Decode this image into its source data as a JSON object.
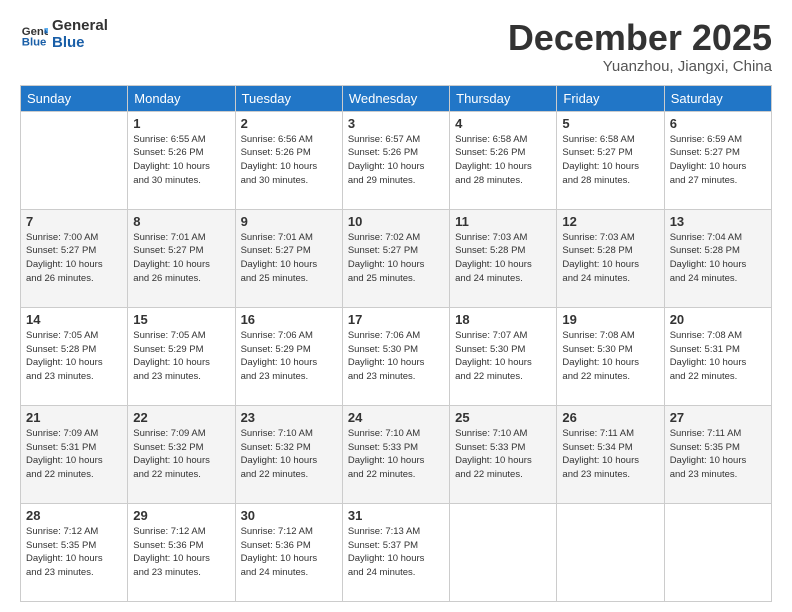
{
  "logo": {
    "line1": "General",
    "line2": "Blue"
  },
  "title": "December 2025",
  "subtitle": "Yuanzhou, Jiangxi, China",
  "days_of_week": [
    "Sunday",
    "Monday",
    "Tuesday",
    "Wednesday",
    "Thursday",
    "Friday",
    "Saturday"
  ],
  "weeks": [
    [
      {
        "day": "",
        "info": ""
      },
      {
        "day": "1",
        "info": "Sunrise: 6:55 AM\nSunset: 5:26 PM\nDaylight: 10 hours\nand 30 minutes."
      },
      {
        "day": "2",
        "info": "Sunrise: 6:56 AM\nSunset: 5:26 PM\nDaylight: 10 hours\nand 30 minutes."
      },
      {
        "day": "3",
        "info": "Sunrise: 6:57 AM\nSunset: 5:26 PM\nDaylight: 10 hours\nand 29 minutes."
      },
      {
        "day": "4",
        "info": "Sunrise: 6:58 AM\nSunset: 5:26 PM\nDaylight: 10 hours\nand 28 minutes."
      },
      {
        "day": "5",
        "info": "Sunrise: 6:58 AM\nSunset: 5:27 PM\nDaylight: 10 hours\nand 28 minutes."
      },
      {
        "day": "6",
        "info": "Sunrise: 6:59 AM\nSunset: 5:27 PM\nDaylight: 10 hours\nand 27 minutes."
      }
    ],
    [
      {
        "day": "7",
        "info": "Sunrise: 7:00 AM\nSunset: 5:27 PM\nDaylight: 10 hours\nand 26 minutes."
      },
      {
        "day": "8",
        "info": "Sunrise: 7:01 AM\nSunset: 5:27 PM\nDaylight: 10 hours\nand 26 minutes."
      },
      {
        "day": "9",
        "info": "Sunrise: 7:01 AM\nSunset: 5:27 PM\nDaylight: 10 hours\nand 25 minutes."
      },
      {
        "day": "10",
        "info": "Sunrise: 7:02 AM\nSunset: 5:27 PM\nDaylight: 10 hours\nand 25 minutes."
      },
      {
        "day": "11",
        "info": "Sunrise: 7:03 AM\nSunset: 5:28 PM\nDaylight: 10 hours\nand 24 minutes."
      },
      {
        "day": "12",
        "info": "Sunrise: 7:03 AM\nSunset: 5:28 PM\nDaylight: 10 hours\nand 24 minutes."
      },
      {
        "day": "13",
        "info": "Sunrise: 7:04 AM\nSunset: 5:28 PM\nDaylight: 10 hours\nand 24 minutes."
      }
    ],
    [
      {
        "day": "14",
        "info": "Sunrise: 7:05 AM\nSunset: 5:28 PM\nDaylight: 10 hours\nand 23 minutes."
      },
      {
        "day": "15",
        "info": "Sunrise: 7:05 AM\nSunset: 5:29 PM\nDaylight: 10 hours\nand 23 minutes."
      },
      {
        "day": "16",
        "info": "Sunrise: 7:06 AM\nSunset: 5:29 PM\nDaylight: 10 hours\nand 23 minutes."
      },
      {
        "day": "17",
        "info": "Sunrise: 7:06 AM\nSunset: 5:30 PM\nDaylight: 10 hours\nand 23 minutes."
      },
      {
        "day": "18",
        "info": "Sunrise: 7:07 AM\nSunset: 5:30 PM\nDaylight: 10 hours\nand 22 minutes."
      },
      {
        "day": "19",
        "info": "Sunrise: 7:08 AM\nSunset: 5:30 PM\nDaylight: 10 hours\nand 22 minutes."
      },
      {
        "day": "20",
        "info": "Sunrise: 7:08 AM\nSunset: 5:31 PM\nDaylight: 10 hours\nand 22 minutes."
      }
    ],
    [
      {
        "day": "21",
        "info": "Sunrise: 7:09 AM\nSunset: 5:31 PM\nDaylight: 10 hours\nand 22 minutes."
      },
      {
        "day": "22",
        "info": "Sunrise: 7:09 AM\nSunset: 5:32 PM\nDaylight: 10 hours\nand 22 minutes."
      },
      {
        "day": "23",
        "info": "Sunrise: 7:10 AM\nSunset: 5:32 PM\nDaylight: 10 hours\nand 22 minutes."
      },
      {
        "day": "24",
        "info": "Sunrise: 7:10 AM\nSunset: 5:33 PM\nDaylight: 10 hours\nand 22 minutes."
      },
      {
        "day": "25",
        "info": "Sunrise: 7:10 AM\nSunset: 5:33 PM\nDaylight: 10 hours\nand 22 minutes."
      },
      {
        "day": "26",
        "info": "Sunrise: 7:11 AM\nSunset: 5:34 PM\nDaylight: 10 hours\nand 23 minutes."
      },
      {
        "day": "27",
        "info": "Sunrise: 7:11 AM\nSunset: 5:35 PM\nDaylight: 10 hours\nand 23 minutes."
      }
    ],
    [
      {
        "day": "28",
        "info": "Sunrise: 7:12 AM\nSunset: 5:35 PM\nDaylight: 10 hours\nand 23 minutes."
      },
      {
        "day": "29",
        "info": "Sunrise: 7:12 AM\nSunset: 5:36 PM\nDaylight: 10 hours\nand 23 minutes."
      },
      {
        "day": "30",
        "info": "Sunrise: 7:12 AM\nSunset: 5:36 PM\nDaylight: 10 hours\nand 24 minutes."
      },
      {
        "day": "31",
        "info": "Sunrise: 7:13 AM\nSunset: 5:37 PM\nDaylight: 10 hours\nand 24 minutes."
      },
      {
        "day": "",
        "info": ""
      },
      {
        "day": "",
        "info": ""
      },
      {
        "day": "",
        "info": ""
      }
    ]
  ]
}
